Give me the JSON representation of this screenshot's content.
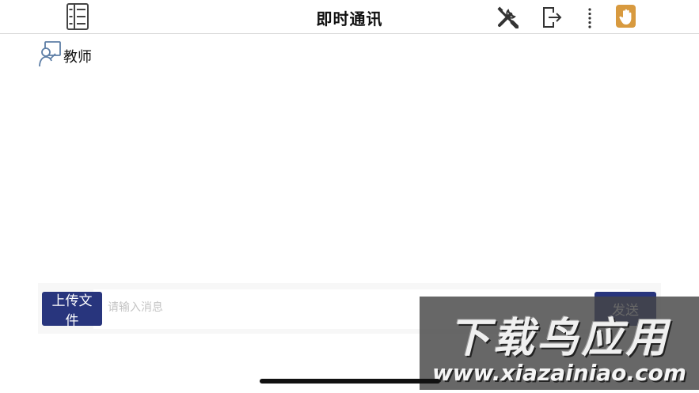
{
  "header": {
    "title": "即时通讯",
    "icons": {
      "menu": "list-menu-icon",
      "tools": "tools-icon",
      "logout": "logout-icon",
      "more": "more-vertical-icon",
      "raise_hand": "raise-hand-icon"
    },
    "raise_hand_color": "#d89a3f"
  },
  "participant": {
    "avatar_icon": "teacher-icon",
    "label": "教师"
  },
  "composer": {
    "upload_label": "上传文件",
    "placeholder": "请输入消息",
    "value": "",
    "send_label": "发送",
    "button_color": "#28357d"
  },
  "watermark": {
    "title": "下载鸟应用",
    "url": "www.xiazainiao.com"
  }
}
